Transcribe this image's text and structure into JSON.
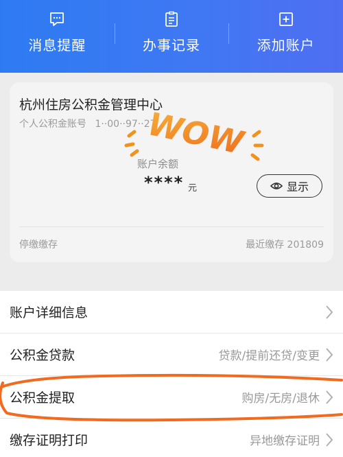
{
  "header": {
    "items": [
      {
        "label": "消息提醒",
        "icon": "message-icon"
      },
      {
        "label": "办事记录",
        "icon": "record-icon"
      },
      {
        "label": "添加账户",
        "icon": "add-account-icon"
      }
    ]
  },
  "card": {
    "title": "杭州住房公积金管理中心",
    "account_label": "个人公积金账号",
    "account_value": "1··00··97··27",
    "sticker": "WOW",
    "balance_label": "账户余额",
    "balance_value": "****",
    "balance_unit": "元",
    "show_button": "显示",
    "status": "停缴缴存",
    "last_deposit": "最近缴存 201809"
  },
  "menu": [
    {
      "label": "账户详细信息",
      "sub": ""
    },
    {
      "label": "公积金贷款",
      "sub": "贷款/提前还贷/变更"
    },
    {
      "label": "公积金提取",
      "sub": "购房/无房/退休"
    },
    {
      "label": "缴存证明打印",
      "sub": "异地缴存证明"
    }
  ],
  "colors": {
    "header_start": "#2d7bf2",
    "header_end": "#4f6ef2",
    "highlight": "#f26a1f",
    "sticker_orange": "#f0921e"
  }
}
